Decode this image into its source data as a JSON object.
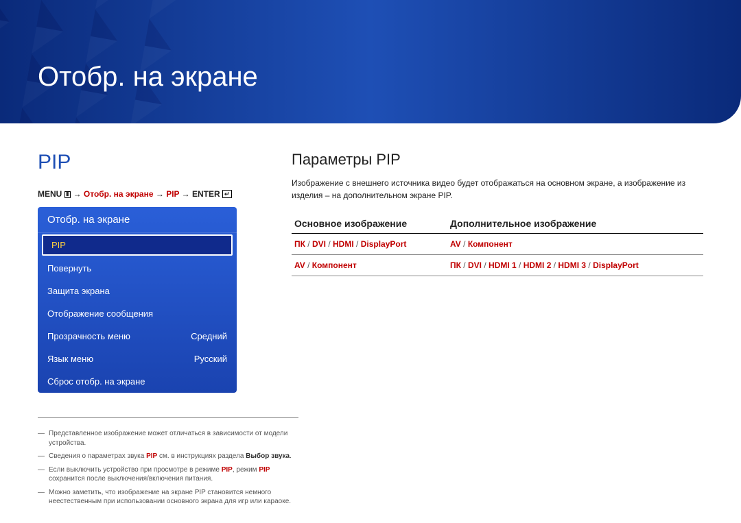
{
  "banner": {
    "title": "Отобр. на экране"
  },
  "left": {
    "heading": "PIP",
    "breadcrumb": {
      "menu": "MENU",
      "arrow": " → ",
      "p1": "Отобр. на экране",
      "p2": "PIP",
      "enter": "ENTER"
    },
    "osd": {
      "header": "Отобр. на экране",
      "items": [
        {
          "label": "PIP",
          "value": "",
          "selected": true
        },
        {
          "label": "Повернуть",
          "value": ""
        },
        {
          "label": "Защита экрана",
          "value": ""
        },
        {
          "label": "Отображение сообщения",
          "value": ""
        },
        {
          "label": "Прозрачность меню",
          "value": "Средний"
        },
        {
          "label": "Язык меню",
          "value": "Русский"
        },
        {
          "label": "Сброс отобр. на экране",
          "value": ""
        }
      ]
    },
    "notes": {
      "n1": "Представленное изображение может отличаться в зависимости от модели устройства.",
      "n2a": "Сведения о параметрах звука ",
      "n2b": "PIP",
      "n2c": " см. в инструкциях раздела ",
      "n2d": "Выбор звука",
      "n2e": ".",
      "n3a": "Если выключить устройство при просмотре в режиме ",
      "n3b": "PIP",
      "n3c": ", режим ",
      "n3d": "PIP",
      "n3e": " сохранится после выключения/включения питания.",
      "n4": "Можно заметить, что изображение на экране PIP становится немного неестественным при использовании основного экрана для игр или караоке."
    }
  },
  "right": {
    "heading": "Параметры PIP",
    "desc": "Изображение с внешнего источника видео будет отображаться на основном экране, а изображение из изделия – на дополнительном экране PIP.",
    "table": {
      "h1": "Основное изображение",
      "h2": "Дополнительное изображение",
      "rows": [
        {
          "c1": [
            "ПК",
            "DVI",
            "HDMI",
            "DisplayPort"
          ],
          "c2": [
            "AV",
            "Компонент"
          ]
        },
        {
          "c1": [
            "AV",
            "Компонент"
          ],
          "c2": [
            "ПК",
            "DVI",
            "HDMI 1",
            "HDMI 2",
            "HDMI 3",
            "DisplayPort"
          ]
        }
      ]
    }
  }
}
